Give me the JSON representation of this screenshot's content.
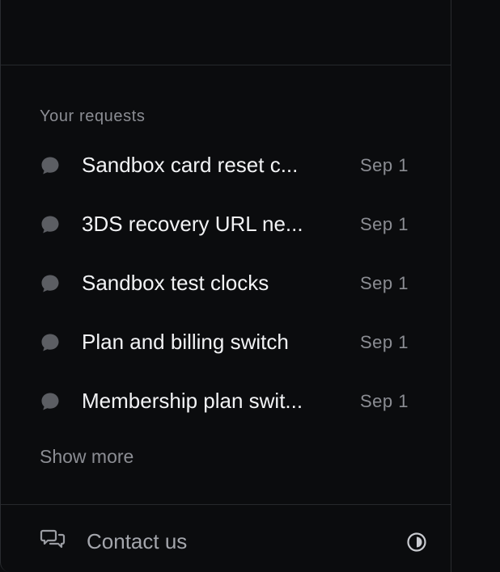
{
  "requests_section": {
    "title": "Your requests",
    "items": [
      {
        "title": "Sandbox card reset c...",
        "date": "Sep 1"
      },
      {
        "title": "3DS recovery URL ne...",
        "date": "Sep 1"
      },
      {
        "title": "Sandbox test clocks",
        "date": "Sep 1"
      },
      {
        "title": "Plan and billing switch",
        "date": "Sep 1"
      },
      {
        "title": "Membership plan swit...",
        "date": "Sep 1"
      }
    ],
    "show_more_label": "Show more"
  },
  "footer": {
    "contact_label": "Contact us"
  },
  "icons": {
    "request": "chat-bubble-icon",
    "contact": "chat-bubbles-icon",
    "theme": "contrast-icon"
  },
  "colors": {
    "background": "#0b0c0e",
    "divider": "#26282c",
    "text_primary": "#f2f3f5",
    "text_muted": "#8b8d93",
    "icon": "#5c5e63"
  }
}
